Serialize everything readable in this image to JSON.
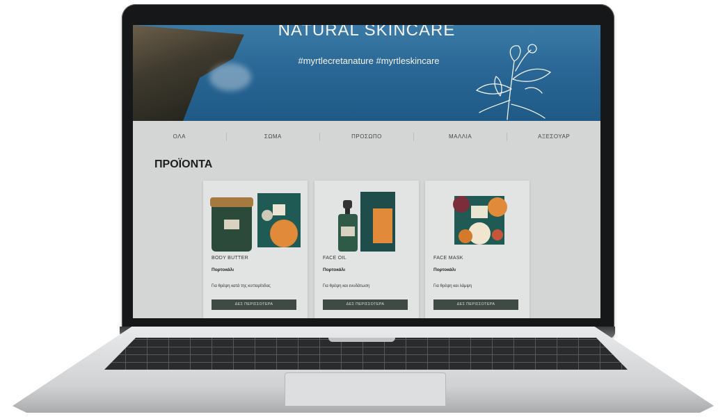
{
  "hero": {
    "title": "NATURAL SKINCARE",
    "hashtags": "#myrtlecretanature  #myrtleskincare"
  },
  "nav": {
    "items": [
      "ΟΛΑ",
      "ΣΩΜΑ",
      "ΠΡΟΣΩΠΟ",
      "ΜΑΛΛΙΑ",
      "ΑΞΕΣΟΥΑΡ"
    ]
  },
  "products_section": {
    "title": "ΠΡΟΪΟΝΤΑ"
  },
  "products": [
    {
      "name": "BODY BUTTER",
      "variant": "Πορτοκάλι",
      "description": "Για θρέψη κατά της κυτταρίτιδας",
      "button": "ΔΕΣ ΠΕΡΙΣΣΟΤΕΡΑ"
    },
    {
      "name": "FACE OIL",
      "variant": "Πορτοκάλι",
      "description": "Για θρέψη και ενυδάτωση",
      "button": "ΔΕΣ ΠΕΡΙΣΣΟΤΕΡΑ"
    },
    {
      "name": "FACE MASK",
      "variant": "Πορτοκάλι",
      "description": "Για θρέψη και λάμψη",
      "button": "ΔΕΣ ΠΕΡΙΣΣΟΤΕΡΑ"
    }
  ],
  "colors": {
    "button_bg": "#3f4a44",
    "packaging_teal": "#1f5a55",
    "accent_orange": "#e08a3a"
  }
}
